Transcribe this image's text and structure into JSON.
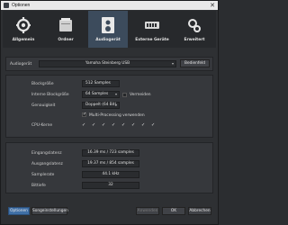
{
  "window": {
    "title": "Optionen",
    "close_glyph": "✕"
  },
  "tabs": [
    {
      "label": "Allgemein",
      "icon": "gear-icon"
    },
    {
      "label": "Ordner",
      "icon": "folder-icon"
    },
    {
      "label": "Audiogerät",
      "icon": "audio-device-icon",
      "active": true
    },
    {
      "label": "Externe Geräte",
      "icon": "external-devices-icon"
    },
    {
      "label": "Erweitert",
      "icon": "advanced-icon"
    }
  ],
  "device": {
    "label": "Audiogerät",
    "value": "Yamaha Steinberg USB",
    "settings_button": "Bedienfeld"
  },
  "buffer": {
    "block_size_label": "Blockgröße",
    "block_size_value": "512 Samples",
    "internal_block_label": "Interne Blockgröße",
    "internal_block_value": "64 Samples",
    "internal_block_checkbox": "Vermeiden",
    "precision_label": "Genauigkeit",
    "precision_value": "Doppelt (64 Bit)",
    "multiprocessing_label": "Multi-Processing verwenden",
    "cpu_label": "CPU-Kerne"
  },
  "latency": {
    "input_label": "Eingangslatenz",
    "input_value": "16.39 ms / 723 samples",
    "output_label": "Ausgangslatenz",
    "output_value": "19.37 ms / 854 samples",
    "rate_label": "Samplerate",
    "rate_value": "44.1 kHz",
    "bits_label": "Bittiefe",
    "bits_value": "32"
  },
  "footer": {
    "options_button": "Optionen",
    "song_settings_button": "Songeinstellungen",
    "apply_button": "Anwenden",
    "ok_button": "OK",
    "cancel_button": "Abbrechen"
  },
  "colors": {
    "accent": "#3f6fa6",
    "active_tab": "#3c4b5c"
  }
}
